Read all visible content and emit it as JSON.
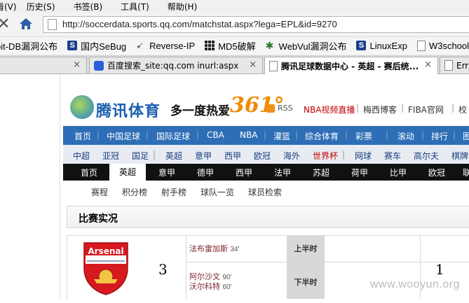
{
  "browser": {
    "menu": [
      "看(V)",
      "历史(S)",
      "书签(B)",
      "工具(T)",
      "帮助(H)"
    ],
    "url": "http://soccerdata.sports.qq.com/matchstat.aspx?lega=EPL&id=9270",
    "bookmarks": [
      {
        "label": "bit-DB漏洞公布",
        "icon": "none"
      },
      {
        "label": "国内SeBug",
        "icon": "s-icon"
      },
      {
        "label": "Reverse-IP",
        "icon": "arrow-icon"
      },
      {
        "label": "MD5破解",
        "icon": "grid-icon"
      },
      {
        "label": "WebVul漏洞公布",
        "icon": "bug-icon"
      },
      {
        "label": "LinuxExp",
        "icon": "s-icon"
      },
      {
        "label": "W3school",
        "icon": "page-icon"
      },
      {
        "label": "百度",
        "icon": "paw-icon"
      }
    ],
    "tabs": [
      {
        "label": "",
        "active": false
      },
      {
        "label": "百度搜索_site:qq.com inurl:aspx",
        "active": false
      },
      {
        "label": "腾讯足球数据中心 - 英超 - 赛后统...",
        "active": true
      },
      {
        "label": "Err",
        "active": false
      }
    ],
    "tab_close": "×"
  },
  "site": {
    "logo_text": "腾讯体育",
    "slogan": "多一度热爱",
    "slogan_number": "361°",
    "rss": "RSS",
    "top_links": [
      {
        "label": "NBA视频直播",
        "red": true
      },
      {
        "label": "梅西博客",
        "red": false
      },
      {
        "label": "FIBA官网",
        "red": false
      },
      {
        "label": "校",
        "red": false
      }
    ],
    "blue_nav": [
      "首页",
      "中国足球",
      "国际足球",
      "CBA",
      "NBA",
      "灌篮",
      "综合体育",
      "彩票",
      "滚动",
      "排行",
      "图"
    ],
    "grey_nav": [
      {
        "label": "中超",
        "red": false
      },
      {
        "label": "亚冠",
        "red": false
      },
      {
        "label": "国足",
        "red": false
      },
      {
        "label": "英超",
        "red": false
      },
      {
        "label": "意甲",
        "red": false
      },
      {
        "label": "西甲",
        "red": false
      },
      {
        "label": "欧冠",
        "red": false
      },
      {
        "label": "海外",
        "red": false
      },
      {
        "label": "世界杯",
        "red": true
      },
      {
        "label": "网球",
        "red": false
      },
      {
        "label": "赛车",
        "red": false
      },
      {
        "label": "高尔夫",
        "red": false
      },
      {
        "label": "棋牌",
        "red": false
      }
    ],
    "league_nav": [
      "首页",
      "英超",
      "意甲",
      "德甲",
      "西甲",
      "法甲",
      "苏超",
      "荷甲",
      "比甲",
      "欧冠",
      "联"
    ],
    "league_active": "英超",
    "sub_nav": [
      "赛程",
      "积分榜",
      "射手榜",
      "球队一览",
      "球员检索"
    ]
  },
  "match": {
    "panel_title": "比赛实况",
    "home_team": "Arsenal",
    "home_score": "3",
    "away_score": "1",
    "first_half_label": "上半时",
    "second_half_label": "下半时",
    "scorers_first_half": [
      {
        "name": "法布雷加斯",
        "minute": "34'"
      }
    ],
    "scorers_second_half": [
      {
        "name": "阿尔沙文",
        "minute": "90'"
      },
      {
        "name": "沃尔科特",
        "minute": "60'"
      }
    ]
  },
  "watermark": "www.wooyun.org"
}
